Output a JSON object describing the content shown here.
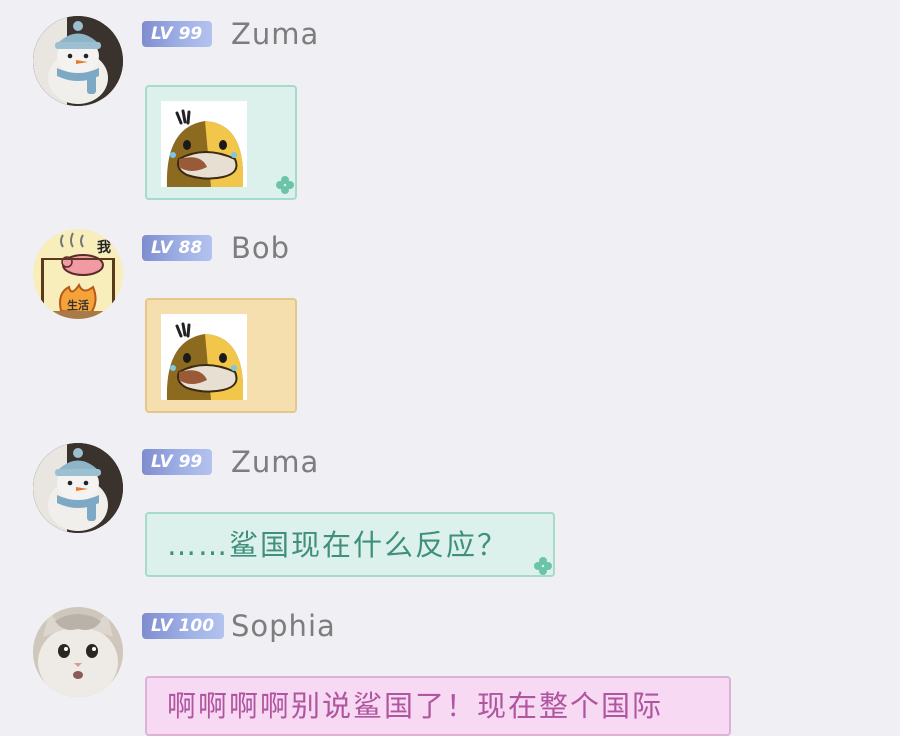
{
  "chat": {
    "messages": [
      {
        "sender": "Zuma",
        "level": "LV 99",
        "avatar_icon": "snowman-avatar-icon",
        "bubble_color": "#dcf1ec",
        "type": "sticker",
        "sticker_icon": "platypus-sticker-icon"
      },
      {
        "sender": "Bob",
        "level": "LV 88",
        "avatar_icon": "pig-campfire-avatar-icon",
        "avatar_text_top": "我",
        "avatar_text_bottom": "生活",
        "bubble_color": "#f5dfaf",
        "type": "sticker",
        "sticker_icon": "platypus-sticker-icon"
      },
      {
        "sender": "Zuma",
        "level": "LV 99",
        "avatar_icon": "snowman-avatar-icon",
        "bubble_color": "#dcf1ec",
        "type": "text",
        "text": "……鲨国现在什么反应？",
        "text_color": "#3f8f7c"
      },
      {
        "sender": "Sophia",
        "level": "LV 100",
        "avatar_icon": "cat-avatar-icon",
        "bubble_color": "#f8d9f3",
        "type": "text",
        "text": "啊啊啊啊别说鲨国了！现在整个国际",
        "text_color": "#b0559f"
      }
    ]
  }
}
